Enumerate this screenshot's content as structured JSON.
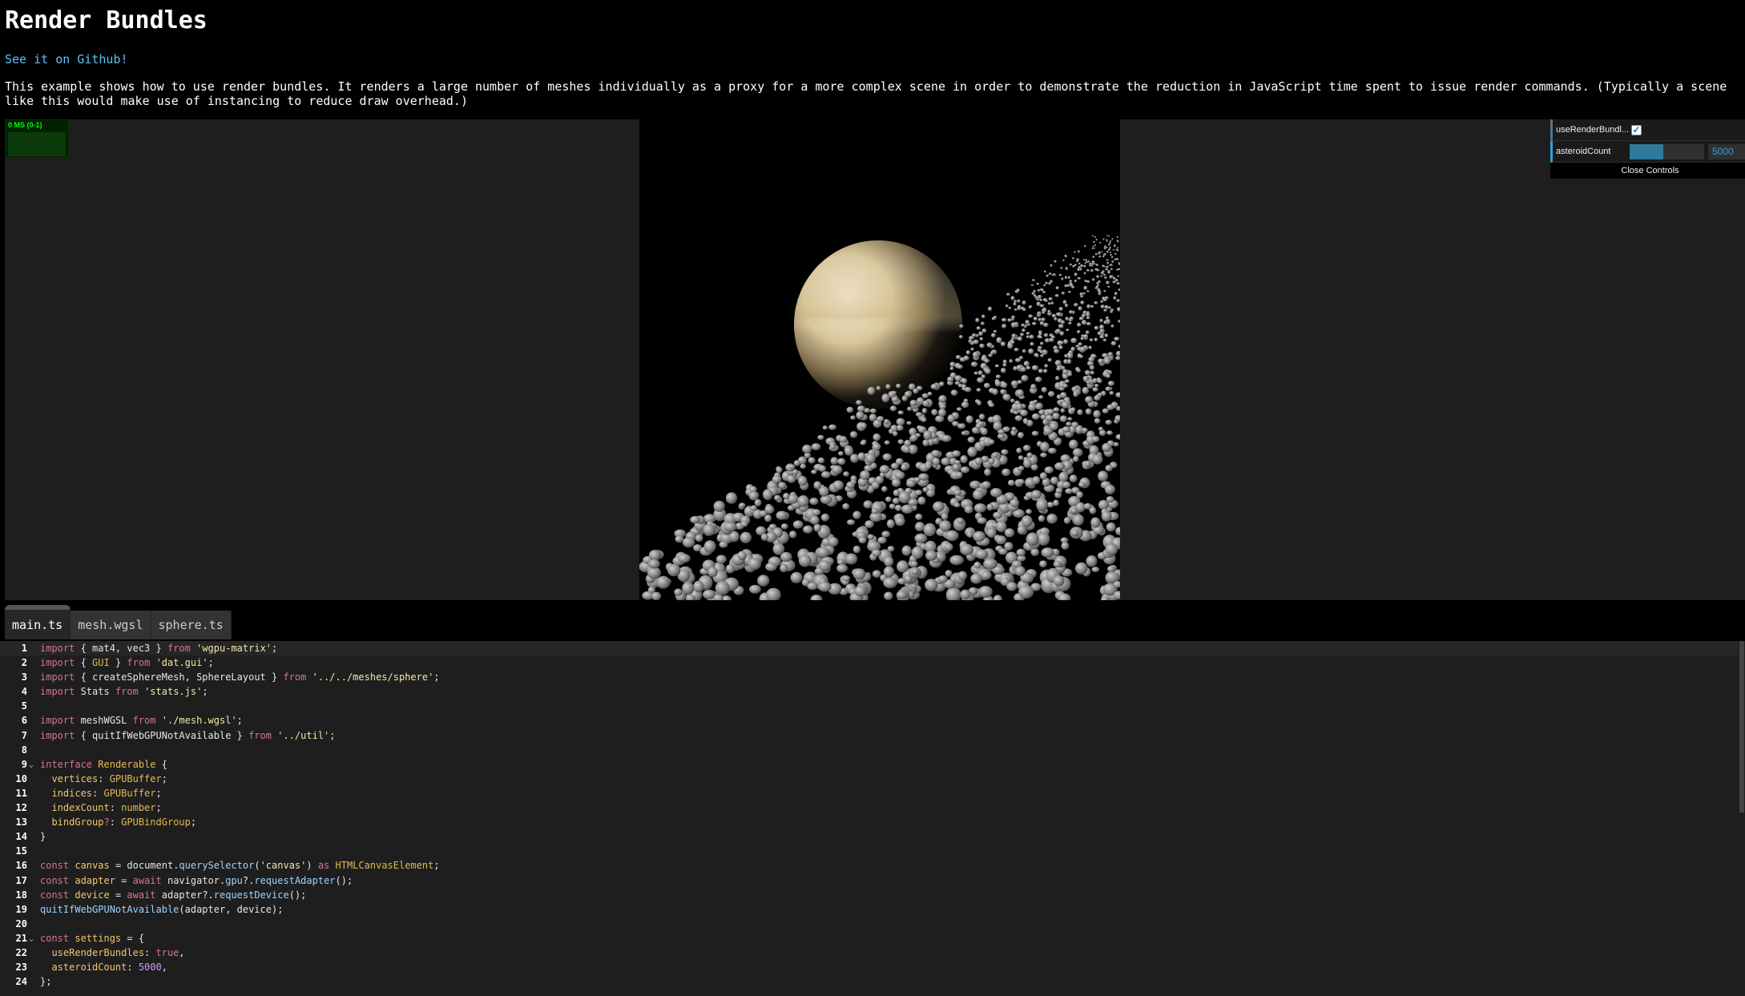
{
  "page": {
    "title": "Render Bundles",
    "github_link": "See it on Github!",
    "description": "This example shows how to use render bundles. It renders a large number of meshes individually as a proxy for a more complex scene in order to demonstrate the reduction in JavaScript time spent to issue render commands. (Typically a scene like this would make use of instancing to reduce draw overhead.)"
  },
  "stats": {
    "label": "0 MS (0-1)"
  },
  "gui": {
    "use_render_bundles_label": "useRenderBundl...",
    "use_render_bundles_checked": true,
    "asteroid_count_label": "asteroidCount",
    "asteroid_count_value": "5000",
    "asteroid_count_fraction": 0.45,
    "close_label": "Close Controls"
  },
  "tabs": [
    {
      "label": "main.ts",
      "active": true
    },
    {
      "label": "mesh.wgsl",
      "active": false
    },
    {
      "label": "sphere.ts",
      "active": false
    }
  ],
  "code_lines": [
    {
      "n": "1",
      "fold": false,
      "html": "<span class=\"kwl\">import</span> { mat4, vec3 } <span class=\"kwl\">from</span> <span class=\"str\">'wgpu-matrix'</span>;"
    },
    {
      "n": "2",
      "fold": false,
      "html": "<span class=\"kwl\">import</span> { <span class=\"typ\">GUI</span> } <span class=\"kwl\">from</span> <span class=\"str\">'dat.gui'</span>;"
    },
    {
      "n": "3",
      "fold": false,
      "html": "<span class=\"kwl\">import</span> { createSphereMesh, SphereLayout } <span class=\"kwl\">from</span> <span class=\"str\">'../../meshes/sphere'</span>;"
    },
    {
      "n": "4",
      "fold": false,
      "html": "<span class=\"kwl\">import</span> Stats <span class=\"kwl\">from</span> <span class=\"str\">'stats.js'</span>;"
    },
    {
      "n": "5",
      "fold": false,
      "html": ""
    },
    {
      "n": "6",
      "fold": false,
      "html": "<span class=\"kwl\">import</span> meshWGSL <span class=\"kwl\">from</span> <span class=\"str\">'./mesh.wgsl'</span>;"
    },
    {
      "n": "7",
      "fold": false,
      "html": "<span class=\"kwl\">import</span> { quitIfWebGPUNotAvailable } <span class=\"kwl\">from</span> <span class=\"str\">'../util'</span>;"
    },
    {
      "n": "8",
      "fold": false,
      "html": ""
    },
    {
      "n": "9",
      "fold": true,
      "html": "<span class=\"kwl\">interface</span> <span class=\"typ\">Renderable</span> {"
    },
    {
      "n": "10",
      "fold": false,
      "html": "  <span class=\"prop\">vertices</span>: <span class=\"typ\">GPUBuffer</span>;"
    },
    {
      "n": "11",
      "fold": false,
      "html": "  <span class=\"prop\">indices</span>: <span class=\"typ\">GPUBuffer</span>;"
    },
    {
      "n": "12",
      "fold": false,
      "html": "  <span class=\"prop\">indexCount</span>: <span class=\"typ\">number</span>;"
    },
    {
      "n": "13",
      "fold": false,
      "html": "  <span class=\"prop\">bindGroup</span><span class=\"kwl\">?</span>: <span class=\"typ\">GPUBindGroup</span>;"
    },
    {
      "n": "14",
      "fold": false,
      "html": "}"
    },
    {
      "n": "15",
      "fold": false,
      "html": ""
    },
    {
      "n": "16",
      "fold": false,
      "html": "<span class=\"kwl\">const</span> <span class=\"prop\">canvas</span> = document.<span class=\"fn\">querySelector</span>(<span class=\"str\">'canvas'</span>) <span class=\"kwl\">as</span> <span class=\"typ\">HTMLCanvasElement</span>;"
    },
    {
      "n": "17",
      "fold": false,
      "html": "<span class=\"kwl\">const</span> <span class=\"prop\">adapter</span> = <span class=\"kwl\">await</span> navigator.<span class=\"fn\">gpu</span>?.<span class=\"fn\">requestAdapter</span>();"
    },
    {
      "n": "18",
      "fold": false,
      "html": "<span class=\"kwl\">const</span> <span class=\"prop\">device</span> = <span class=\"kwl\">await</span> adapter?.<span class=\"fn\">requestDevice</span>();"
    },
    {
      "n": "19",
      "fold": false,
      "html": "<span class=\"fn\">quitIfWebGPUNotAvailable</span>(adapter, device);"
    },
    {
      "n": "20",
      "fold": false,
      "html": ""
    },
    {
      "n": "21",
      "fold": true,
      "html": "<span class=\"kwl\">const</span> <span class=\"prop\">settings</span> = {"
    },
    {
      "n": "22",
      "fold": false,
      "html": "  <span class=\"prop\">useRenderBundles</span>: <span class=\"kwl\">true</span>,"
    },
    {
      "n": "23",
      "fold": false,
      "html": "  <span class=\"prop\">asteroidCount</span>: <span class=\"num\">5000</span>,"
    },
    {
      "n": "24",
      "fold": false,
      "html": "};"
    }
  ]
}
